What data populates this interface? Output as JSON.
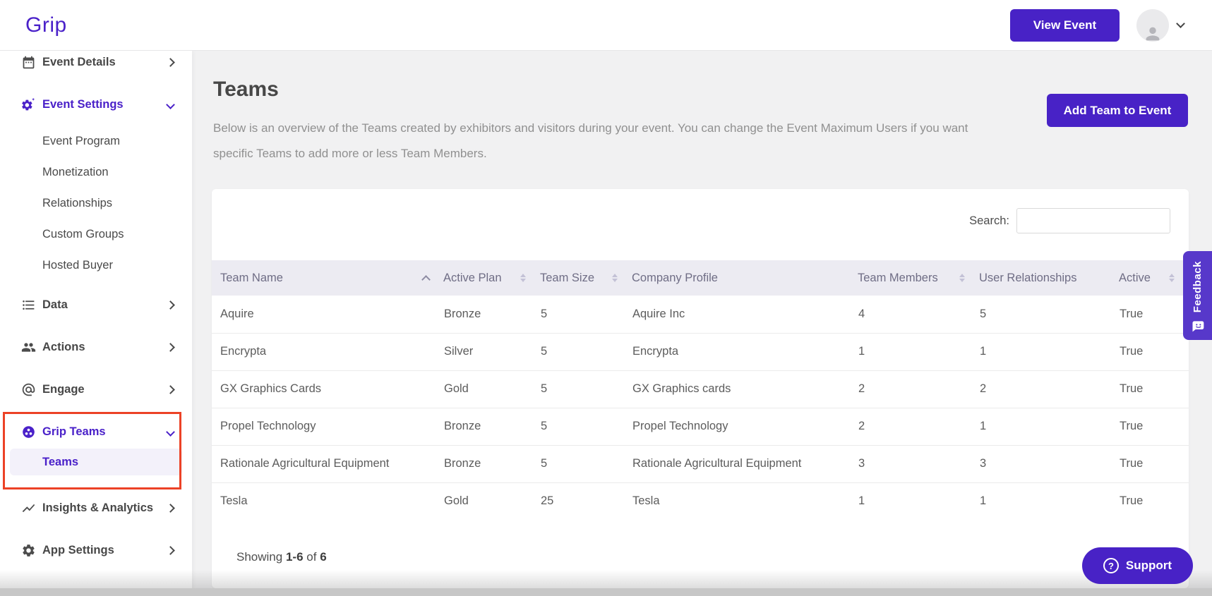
{
  "brand": {
    "logo_text": "Grip",
    "colors": {
      "primary_purple": "#4822c6",
      "logo_purple": "#4a21c9",
      "feedback_purple": "#5738ca",
      "highlight_red": "#ec4226",
      "table_header_bg": "#ecebf2",
      "selected_pill_bg": "#f3f1fa"
    }
  },
  "header": {
    "view_event_button": "View Event",
    "icons": [
      "avatar-person-icon",
      "chevron-down-icon"
    ]
  },
  "sidebar": {
    "items": [
      {
        "label": "Event Details",
        "icon": "calendar-icon",
        "chevron": "right"
      },
      {
        "label": "Event Settings",
        "icon": "gear-sparkle-icon",
        "chevron": "down",
        "active": true,
        "children": [
          "Event Program",
          "Monetization",
          "Relationships",
          "Custom Groups",
          "Hosted Buyer"
        ]
      },
      {
        "label": "Data",
        "icon": "list-icon",
        "chevron": "right"
      },
      {
        "label": "Actions",
        "icon": "people-icon",
        "chevron": "right"
      },
      {
        "label": "Engage",
        "icon": "at-sign-icon",
        "chevron": "right"
      },
      {
        "label": "Grip Teams",
        "icon": "team-circle-icon",
        "chevron": "down",
        "active": true,
        "highlighted": true,
        "children": [
          "Teams"
        ]
      },
      {
        "label": "Insights & Analytics",
        "icon": "trend-line-icon",
        "chevron": "right"
      },
      {
        "label": "App Settings",
        "icon": "gear-icon",
        "chevron": "right"
      }
    ],
    "selected_subitem": "Teams"
  },
  "main": {
    "page_title": "Teams",
    "description": "Below is an overview of the Teams created by exhibitors and visitors during your event. You can change the Event Maximum Users if you want specific Teams to add more or less Team Members.",
    "add_team_button": "Add Team to Event",
    "search_label": "Search:",
    "search_value": "",
    "table": {
      "columns": [
        {
          "label": "Team Name",
          "sort": "asc"
        },
        {
          "label": "Active Plan",
          "sort": "both"
        },
        {
          "label": "Team Size",
          "sort": "both"
        },
        {
          "label": "Company Profile",
          "sort": "none"
        },
        {
          "label": "Team Members",
          "sort": "both"
        },
        {
          "label": "User Relationships",
          "sort": "none"
        },
        {
          "label": "Active",
          "sort": "both"
        }
      ],
      "rows": [
        [
          "Aquire",
          "Bronze",
          "5",
          "Aquire Inc",
          "4",
          "5",
          "True"
        ],
        [
          "Encrypta",
          "Silver",
          "5",
          "Encrypta",
          "1",
          "1",
          "True"
        ],
        [
          "GX Graphics Cards",
          "Gold",
          "5",
          "GX Graphics cards",
          "2",
          "2",
          "True"
        ],
        [
          "Propel Technology",
          "Bronze",
          "5",
          "Propel Technology",
          "2",
          "1",
          "True"
        ],
        [
          "Rationale Agricultural Equipment",
          "Bronze",
          "5",
          "Rationale Agricultural Equipment",
          "3",
          "3",
          "True"
        ],
        [
          "Tesla",
          "Gold",
          "25",
          "Tesla",
          "1",
          "1",
          "True"
        ]
      ],
      "summary": {
        "showing": "Showing",
        "range": "1-6",
        "of": "of",
        "total": "6"
      }
    }
  },
  "widgets": {
    "feedback_tab": "Feedback",
    "support_button": "Support"
  }
}
